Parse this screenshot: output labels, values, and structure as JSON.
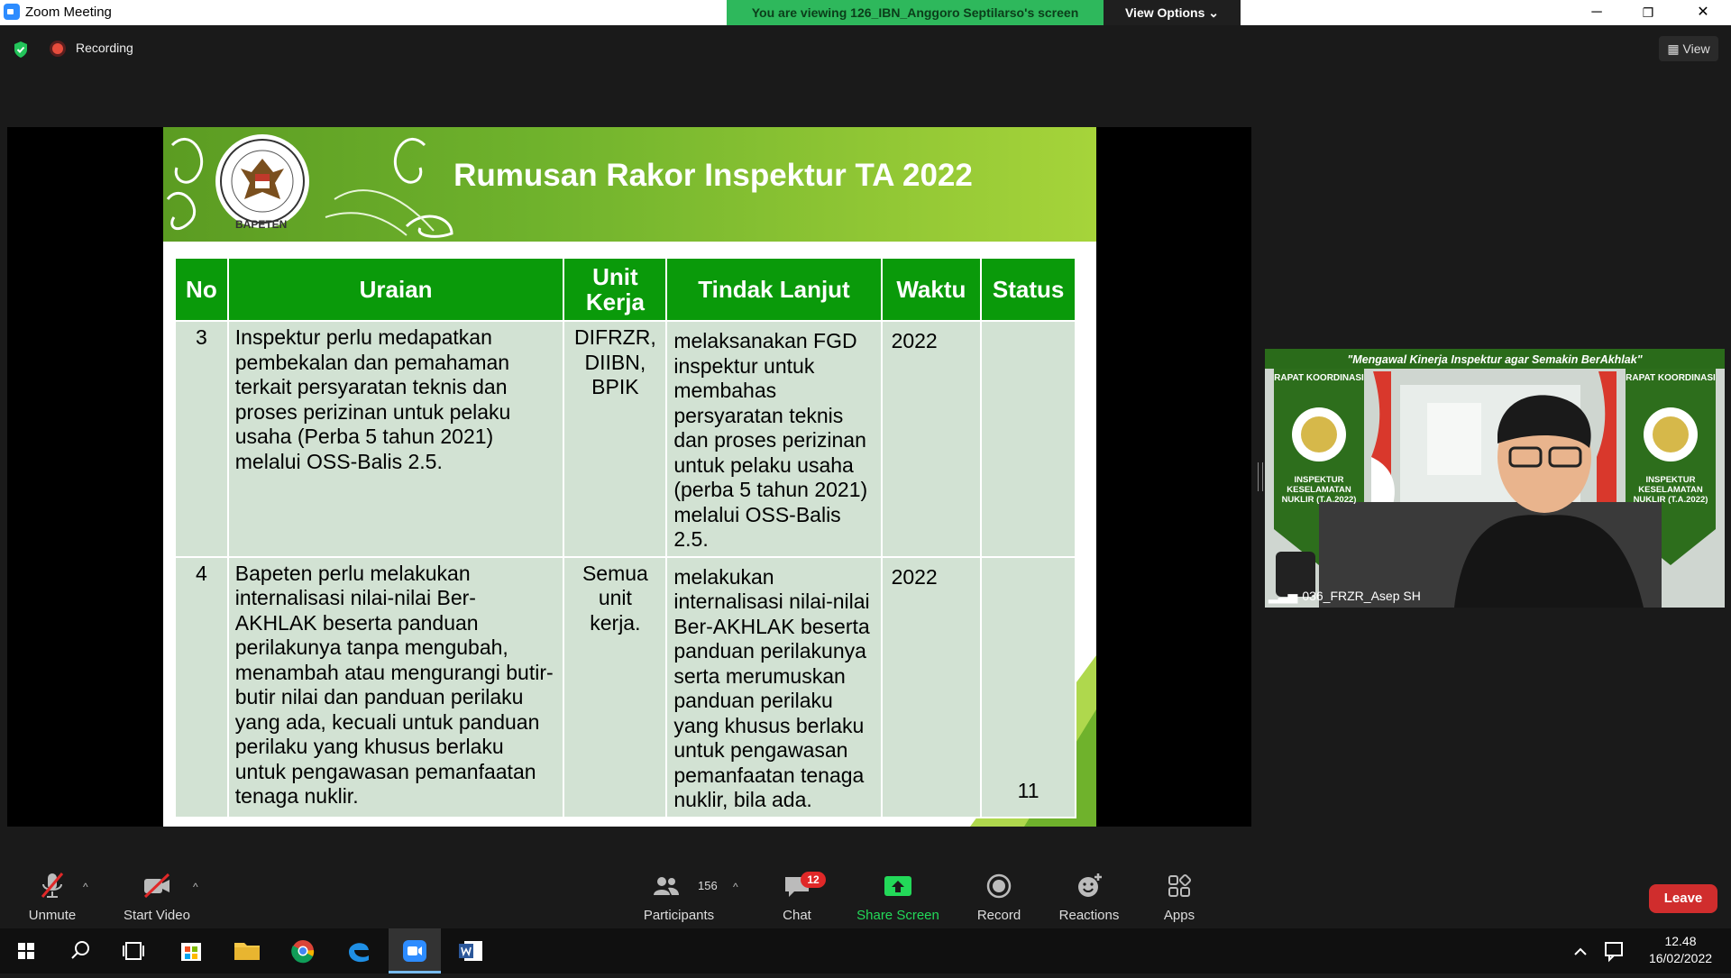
{
  "window": {
    "title": "Zoom Meeting",
    "minimize": "─",
    "maximize": "❐",
    "close": "✕"
  },
  "banner": {
    "viewing_text": "You are viewing 126_IBN_Anggoro Septilarso's screen",
    "view_options": "View Options ⌄"
  },
  "status": {
    "recording": "Recording",
    "view": "View"
  },
  "slide": {
    "title": "Rumusan Rakor Inspektur TA 2022",
    "logo_text": "BAPETEN",
    "headers": [
      "No",
      "Uraian",
      "Unit Kerja",
      "Tindak Lanjut",
      "Waktu",
      "Status"
    ],
    "rows": [
      {
        "no": "3",
        "uraian": "Inspektur perlu medapatkan pembekalan dan pemahaman terkait persyaratan teknis dan proses perizinan untuk pelaku usaha (Perba 5 tahun 2021) melalui OSS-Balis 2.5.",
        "unit": "DIFRZR, DIIBN, BPIK",
        "tindak": "melaksanakan FGD inspektur untuk membahas persyaratan teknis dan proses perizinan untuk pelaku usaha (perba 5 tahun 2021) melalui OSS-Balis 2.5.",
        "waktu": "2022",
        "status": ""
      },
      {
        "no": "4",
        "uraian": "Bapeten perlu melakukan internalisasi nilai-nilai Ber-AKHLAK beserta panduan perilakunya tanpa mengubah, menambah atau mengurangi butir-butir nilai dan panduan perilaku yang ada, kecuali untuk panduan perilaku yang khusus berlaku untuk pengawasan pemanfaatan tenaga nuklir.",
        "unit": "Semua unit kerja.",
        "tindak": "melakukan internalisasi nilai-nilai Ber-AKHLAK beserta panduan perilakunya serta merumuskan panduan perilaku yang khusus berlaku untuk pengawasan pemanfaatan tenaga nuklir, bila ada.",
        "waktu": "2022",
        "status": "11"
      }
    ]
  },
  "participant": {
    "name": "036_FRZR_Asep SH",
    "banner_text": "\"Mengawal Kinerja Inspektur agar Semakin BerAkhlak\"",
    "side_top": "RAPAT KOORDINASI",
    "side_bottom": "INSPEKTUR KESELAMATAN NUKLIR (T.A.2022)"
  },
  "toolbar": {
    "unmute": "Unmute",
    "start_video": "Start Video",
    "participants": "Participants",
    "participants_count": "156",
    "chat": "Chat",
    "chat_badge": "12",
    "share_screen": "Share Screen",
    "record": "Record",
    "reactions": "Reactions",
    "apps": "Apps",
    "leave": "Leave"
  },
  "taskbar": {
    "time": "12.48",
    "date": "16/02/2022"
  },
  "colors": {
    "zoom_blue": "#2d8cff",
    "banner_green": "#2eb85c",
    "share_green": "#23d959",
    "leave_red": "#d02d2d",
    "table_header": "#0a9a0a",
    "table_cell": "#d2e2d3"
  }
}
